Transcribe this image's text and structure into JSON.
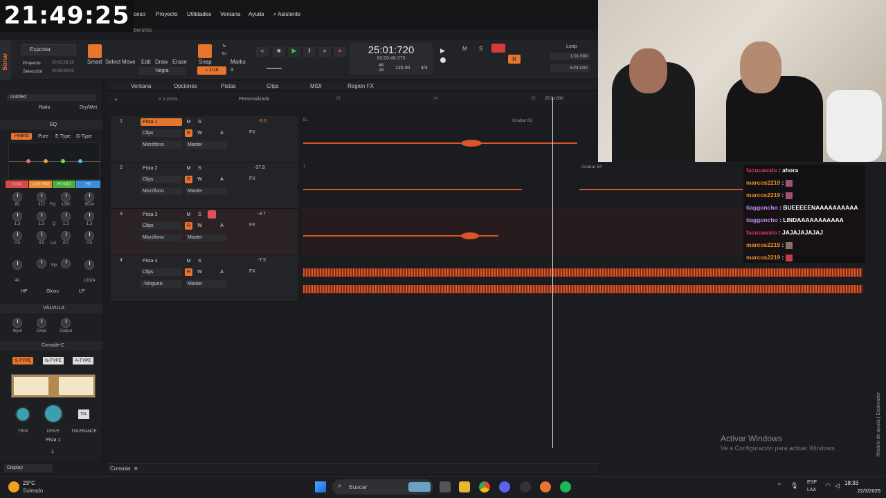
{
  "clock": "21:49:25",
  "menu": [
    "ceso",
    "Proyecto",
    "Utilidades",
    "Ventana",
    "Ayuda",
    "Asistente"
  ],
  "submenu_text": "bership",
  "app": {
    "name": "Sonar"
  },
  "export": {
    "label": "Exportar",
    "proyecto_label": "Proyecto",
    "proyecto_time": "00:03:29:18",
    "seleccion_label": "Selección",
    "seleccion_time": "00:00:00:00"
  },
  "tools": [
    "Smart",
    "Select",
    "Move",
    "Edit",
    "Draw",
    "Erase"
  ],
  "tool_dropdown": "Negra",
  "snap": {
    "label": "Snap",
    "value": "1/16",
    "extra": "3",
    "to": "To",
    "by": "By",
    "marks": "Marks"
  },
  "transport": {
    "time": "25:01:720",
    "subtime": "00:00:48.375",
    "beats": "48",
    "beats_denom": "16",
    "tempo": "120.00",
    "meter": "4/4"
  },
  "loop": {
    "label": "Loop",
    "start": "1:01:000",
    "end": "5:01:000"
  },
  "track_menu": [
    "Ventana",
    "Opciones",
    "Pistas",
    "Clips",
    "MIDI",
    "Region FX"
  ],
  "goto": {
    "placeholder": "Ir a pista...",
    "preset": "Personalizado"
  },
  "ruler": [
    "23",
    "24",
    "25"
  ],
  "playhead_label": "25:01:000",
  "inspector": {
    "project": "Untitled",
    "ratio": "Ratio",
    "drywet": "Dry/Wet"
  },
  "eq": {
    "title": "EQ",
    "modes": [
      "Hybrid",
      "Pure",
      "E-Type",
      "G-Type"
    ],
    "bands": [
      "Low",
      "Low Mid",
      "Hi Mid",
      "Hi"
    ],
    "row1": [
      "80",
      "317",
      "1262",
      "5024"
    ],
    "row1_mid": "Frq",
    "row2": [
      "1.3",
      "1.3",
      "1.3",
      "1.3"
    ],
    "row2_mid": "Q",
    "row3": [
      "0.0",
      "0.0",
      "0.0",
      "0.0"
    ],
    "row3_mid": "Lvl",
    "row4": [
      "40",
      "10024"
    ],
    "row4_mid": "Slp",
    "footer": [
      "HP",
      "Gloss",
      "LP"
    ]
  },
  "valvula": {
    "title": "VÁLVULA",
    "knobs": [
      "Input",
      "Drive",
      "Output"
    ]
  },
  "console": {
    "title": "Console-C",
    "types": [
      "S-TYPE",
      "N-TYPE",
      "A-TYPE"
    ],
    "knobs": [
      "TRIM",
      "DRIVE",
      "TOLERANCE"
    ],
    "track": "Pista 1",
    "num": "1",
    "tol": "TOL"
  },
  "display": "Display",
  "tracks": [
    {
      "num": "1",
      "name": "Pista 1",
      "db": "-9.9",
      "clips": "Clips",
      "input": "Micrófono",
      "output": "Master",
      "fx": "FX"
    },
    {
      "num": "2",
      "name": "Pista 2",
      "db": "-37.5",
      "clips": "Clips",
      "input": "Micrófono",
      "output": "Master",
      "fx": "FX"
    },
    {
      "num": "3",
      "name": "Pista 3",
      "db": "-3.7",
      "clips": "Clips",
      "input": "Micrófono",
      "output": "Master",
      "fx": "FX"
    },
    {
      "num": "4",
      "name": "Pista 4",
      "db": "-7.5",
      "clips": "Clips",
      "input": "-Ninguno-",
      "output": "Master",
      "fx": "FX"
    }
  ],
  "track_btns": [
    "M",
    "S",
    "R",
    "W",
    "A"
  ],
  "lane_labels": {
    "grabar83": "Grabar 83",
    "grabar84": "Grabar 84",
    "b81": "81",
    "n1": "1"
  },
  "chat": [
    {
      "user": "facuuavalo",
      "msg": ": ahora",
      "color": "#e8335a"
    },
    {
      "user": "marcos2219",
      "msg": ":",
      "color": "#f28c28"
    },
    {
      "user": "marcos2219",
      "msg": ":",
      "color": "#f28c28"
    },
    {
      "user": "tiaggoncho",
      "msg": ": BUEEEEENAAAAAAAAAA",
      "color": "#c08ef2"
    },
    {
      "user": "tiaggoncho",
      "msg": ": LINDAAAAAAAAAAA",
      "color": "#c08ef2"
    },
    {
      "user": "facuuavalo",
      "msg": ": JAJAJAJAJAJ",
      "color": "#e8335a"
    },
    {
      "user": "marcos2219",
      "msg": ":",
      "color": "#f28c28"
    },
    {
      "user": "marcos2219",
      "msg": ":",
      "color": "#f28c28"
    }
  ],
  "consola_tab": "Consola",
  "activate": {
    "title": "Activar Windows",
    "sub": "Ve a Configuración para activar Windows."
  },
  "side_help": "Módulo de ayuda | Explorador",
  "weather": {
    "temp": "23°C",
    "desc": "Soleado"
  },
  "search": {
    "placeholder": "Buscar"
  },
  "tray": {
    "lang1": "ESP",
    "lang2": "LAA",
    "time": "18:33",
    "date": "22/3/2026"
  }
}
